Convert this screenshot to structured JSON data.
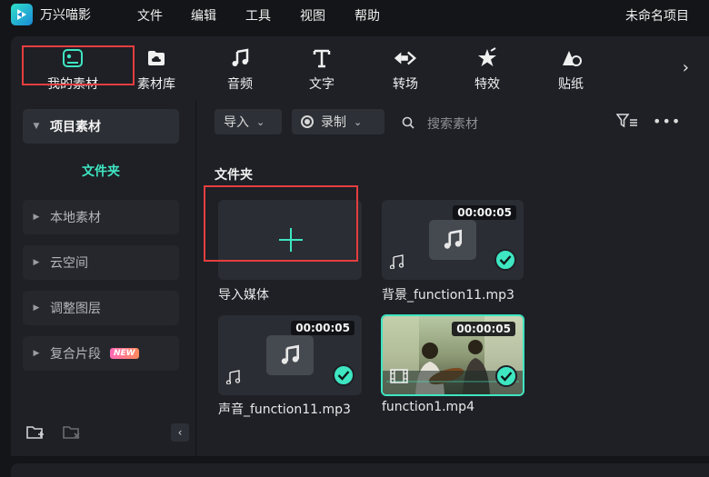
{
  "app": {
    "name": "万兴喵影",
    "project_title": "未命名项目"
  },
  "menu": [
    "文件",
    "编辑",
    "工具",
    "视图",
    "帮助"
  ],
  "toolbar": {
    "tabs": [
      {
        "label": "我的素材",
        "icon": "my-media-icon"
      },
      {
        "label": "素材库",
        "icon": "stock-cloud-icon"
      },
      {
        "label": "音频",
        "icon": "music-note-icon"
      },
      {
        "label": "文字",
        "icon": "text-t-icon"
      },
      {
        "label": "转场",
        "icon": "transition-icon"
      },
      {
        "label": "特效",
        "icon": "effects-star-icon"
      },
      {
        "label": "贴纸",
        "icon": "sticker-icon"
      }
    ],
    "active_tab": "我的素材",
    "more": "›"
  },
  "sidebar": {
    "items": [
      {
        "label": "项目素材",
        "expanded": true
      },
      {
        "label": "文件夹"
      },
      {
        "label": "本地素材"
      },
      {
        "label": "云空间"
      },
      {
        "label": "调整图层"
      },
      {
        "label": "复合片段",
        "badge": "NEW"
      }
    ],
    "collapse": "‹"
  },
  "main": {
    "import_dropdown": "导入",
    "record_dropdown": "录制",
    "search_placeholder": "搜索素材",
    "section_title": "文件夹",
    "media": [
      {
        "caption": "导入媒体",
        "kind": "import"
      },
      {
        "caption": "背景_function11.mp3",
        "kind": "audio",
        "duration": "00:00:05",
        "added": true
      },
      {
        "caption": "声音_function11.mp3",
        "kind": "audio",
        "duration": "00:00:05",
        "added": true
      },
      {
        "caption": "function1.mp4",
        "kind": "video",
        "duration": "00:00:05",
        "added": true,
        "selected": true
      }
    ]
  },
  "colors": {
    "accent": "#3ee6c2",
    "highlight_box": "#e43e3e",
    "panel": "#1e2026",
    "background": "#141518"
  }
}
